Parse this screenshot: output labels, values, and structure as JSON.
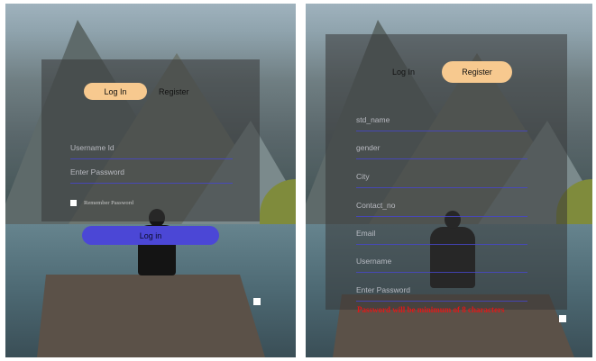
{
  "login_view": {
    "tab_login": "Log In",
    "tab_register": "Register",
    "username_placeholder": "Username Id",
    "password_placeholder": "Enter Password",
    "remember_label": "Remember Password",
    "login_button": "Log in"
  },
  "register_view": {
    "tab_login": "Log In",
    "tab_register": "Register",
    "fields": [
      "std_name",
      "gender",
      "City",
      "Contact_no",
      "Email",
      "Username",
      "Enter Password"
    ],
    "error_message": "Password will be minimum of 8 characters"
  },
  "colors": {
    "active_tab": "#f7c98f",
    "login_button": "#4b47d6",
    "error_text": "#e01818",
    "field_underline": "#4646c8"
  }
}
